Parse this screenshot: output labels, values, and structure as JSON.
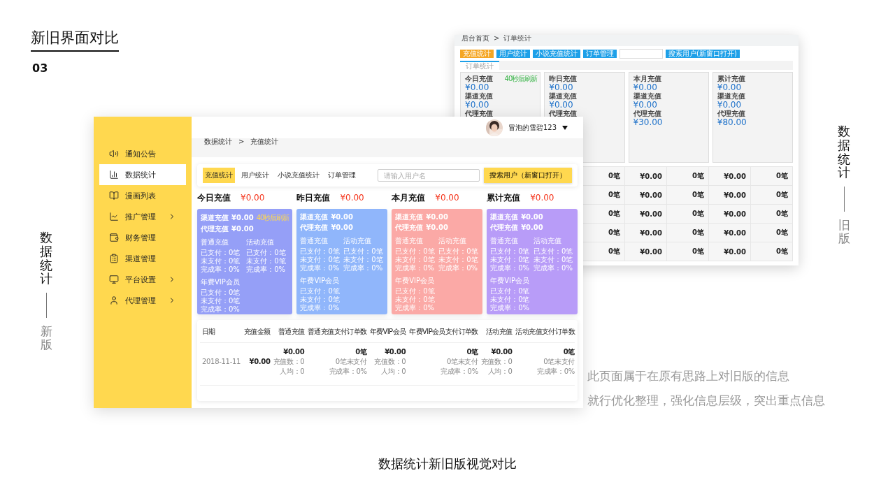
{
  "slide": {
    "title": "新旧界面对比",
    "number": "03",
    "side_left": {
      "title": "数据统计",
      "version": "新版"
    },
    "side_right": {
      "title": "数据统计",
      "version": "旧版"
    },
    "description": [
      "此页面属于在原有思路上对旧版的信息",
      "就行优化整理，强化信息层级，突出重点信息"
    ],
    "caption": "数据统计新旧版视觉对比"
  },
  "old_ui": {
    "breadcrumb": [
      "后台首页",
      "订单统计"
    ],
    "breadcrumb_separator": ">",
    "buttons": [
      {
        "label": "充值统计",
        "selected": true
      },
      {
        "label": "用户统计",
        "selected": false
      },
      {
        "label": "小说充值统计",
        "selected": false
      },
      {
        "label": "订单管理",
        "selected": false
      }
    ],
    "search_button": "搜索用户(新窗口打开)",
    "tab": "订单统计",
    "refresh_note": "40秒后刷新",
    "cards": [
      {
        "title": "今日充值",
        "rows": [
          {
            "value": "¥0.00"
          },
          {
            "label": "渠道充值",
            "value": "¥0.00"
          },
          {
            "label": "代理充值"
          }
        ]
      },
      {
        "title": "昨日充值",
        "rows": [
          {
            "value": "¥0.00"
          },
          {
            "label": "渠道充值",
            "value": "¥0.00"
          },
          {
            "label": "代理充值"
          }
        ]
      },
      {
        "title": "本月充值",
        "rows": [
          {
            "value": "¥0.00"
          },
          {
            "label": "渠道充值",
            "value": "¥0.00"
          },
          {
            "label": "代理充值",
            "value": "¥30.00"
          }
        ]
      },
      {
        "title": "累计充值",
        "rows": [
          {
            "value": "¥0.00"
          },
          {
            "label": "渠道充值",
            "value": "¥0.00"
          },
          {
            "label": "代理充值",
            "value": "¥80.00"
          }
        ]
      }
    ],
    "table": {
      "rows": [
        [
          "0笔",
          "¥0.00",
          "0笔",
          "¥0.00",
          "0笔"
        ],
        [
          "0笔",
          "¥0.00",
          "0笔",
          "¥0.00",
          "0笔"
        ],
        [
          "0笔",
          "¥0.00",
          "0笔",
          "¥0.00",
          "0笔"
        ],
        [
          "0笔",
          "¥0.00",
          "0笔",
          "¥0.00",
          "0笔"
        ],
        [
          "0笔",
          "¥0.00",
          "0笔",
          "¥0.00",
          "0笔"
        ]
      ]
    }
  },
  "new_ui": {
    "sidebar": {
      "items": [
        {
          "label": "通知公告",
          "selected": false,
          "has_submenu": false
        },
        {
          "label": "数据统计",
          "selected": true,
          "has_submenu": false
        },
        {
          "label": "漫画列表",
          "selected": false,
          "has_submenu": false
        },
        {
          "label": "推广管理",
          "selected": false,
          "has_submenu": true
        },
        {
          "label": "财务管理",
          "selected": false,
          "has_submenu": false
        },
        {
          "label": "渠道管理",
          "selected": false,
          "has_submenu": false
        },
        {
          "label": "平台设置",
          "selected": false,
          "has_submenu": true
        },
        {
          "label": "代理管理",
          "selected": false,
          "has_submenu": true
        }
      ]
    },
    "user": {
      "name": "冒泡的雪碧123"
    },
    "breadcrumb": [
      "数据统计",
      "充值统计"
    ],
    "breadcrumb_separator": ">",
    "tabs": [
      {
        "label": "充值统计",
        "selected": true
      },
      {
        "label": "用户统计",
        "selected": false
      },
      {
        "label": "小说充值统计",
        "selected": false
      },
      {
        "label": "订单管理",
        "selected": false
      }
    ],
    "search": {
      "placeholder": "请输入用户名"
    },
    "search_button": "搜索用户（新窗口打开）",
    "summaries": [
      {
        "title": "今日充值",
        "total": "¥0.00",
        "color": "#959ff7",
        "refresh_note": "40秒后刷新",
        "channel": {
          "label": "渠道充值",
          "value": "¥0.00"
        },
        "agent": {
          "label": "代理充值",
          "value": "¥0.00"
        },
        "groups": [
          {
            "title": "普通充值",
            "lines": [
              "已支付：0笔",
              "未支付：0笔",
              "完成率：0%"
            ]
          },
          {
            "title": "活动充值",
            "lines": [
              "已支付：0笔",
              "未支付：0笔",
              "完成率：0%"
            ]
          },
          {
            "title": "年费VIP会员",
            "lines": [
              "已支付：0笔",
              "未支付：0笔",
              "完成率：0%"
            ]
          }
        ]
      },
      {
        "title": "昨日充值",
        "total": "¥0.00",
        "color": "#90b6fb",
        "channel": {
          "label": "渠道充值",
          "value": "¥0.00"
        },
        "agent": {
          "label": "代理充值",
          "value": "¥0.00"
        },
        "groups": [
          {
            "title": "普通充值",
            "lines": [
              "已支付：0笔",
              "未支付：0笔",
              "完成率：0%"
            ]
          },
          {
            "title": "活动充值",
            "lines": [
              "已支付：0笔",
              "未支付：0笔",
              "完成率：0%"
            ]
          },
          {
            "title": "年费VIP会员",
            "lines": [
              "已支付：0笔",
              "未支付：0笔",
              "完成率：0%"
            ]
          }
        ]
      },
      {
        "title": "本月充值",
        "total": "¥0.00",
        "color": "#fba9a6",
        "channel": {
          "label": "渠道充值",
          "value": "¥0.00"
        },
        "agent": {
          "label": "代理充值",
          "value": "¥0.00"
        },
        "groups": [
          {
            "title": "普通充值",
            "lines": [
              "已支付：0笔",
              "未支付：0笔",
              "完成率：0%"
            ]
          },
          {
            "title": "活动充值",
            "lines": [
              "已支付：0笔",
              "未支付：0笔",
              "完成率：0%"
            ]
          },
          {
            "title": "年费VIP会员",
            "lines": [
              "已支付：0笔",
              "未支付：0笔",
              "完成率：0%"
            ]
          }
        ]
      },
      {
        "title": "累计充值",
        "total": "¥0.00",
        "color": "#b89cf8",
        "channel": {
          "label": "渠道充值",
          "value": "¥0.00"
        },
        "agent": {
          "label": "代理充值",
          "value": "¥0.00"
        },
        "groups": [
          {
            "title": "普通充值",
            "lines": [
              "已支付：0笔",
              "未支付：0笔",
              "完成率：0%"
            ]
          },
          {
            "title": "活动充值",
            "lines": [
              "已支付：0笔",
              "未支付：0笔",
              "完成率：0%"
            ]
          },
          {
            "title": "年费VIP会员",
            "lines": [
              "已支付：0笔",
              "未支付：0笔",
              "完成率：0%"
            ]
          }
        ]
      }
    ],
    "table": {
      "columns": [
        "日期",
        "充值金额",
        "普通充值",
        "普通充值支付订单数",
        "年费VIP会员",
        "年费VIP会员支付订单数",
        "活动充值",
        "活动充值支付订单数"
      ],
      "rows": [
        {
          "cells": [
            {
              "lines": [
                "2018-11-11"
              ]
            },
            {
              "lines": [
                "¥0.00"
              ]
            },
            {
              "lines": [
                "¥0.00",
                "充值数：0",
                "人均：0"
              ]
            },
            {
              "lines": [
                "0笔",
                "0笔未支付",
                "完成率：0%"
              ]
            },
            {
              "lines": [
                "¥0.00",
                "充值数：0",
                "人均：0"
              ]
            },
            {
              "lines": [
                "0笔",
                "0笔未支付",
                "完成率：0%"
              ]
            },
            {
              "lines": [
                "¥0.00",
                "充值数：0",
                "人均：0"
              ]
            },
            {
              "lines": [
                "0笔",
                "0笔未支付",
                "完成率：0%"
              ]
            }
          ]
        }
      ]
    }
  }
}
